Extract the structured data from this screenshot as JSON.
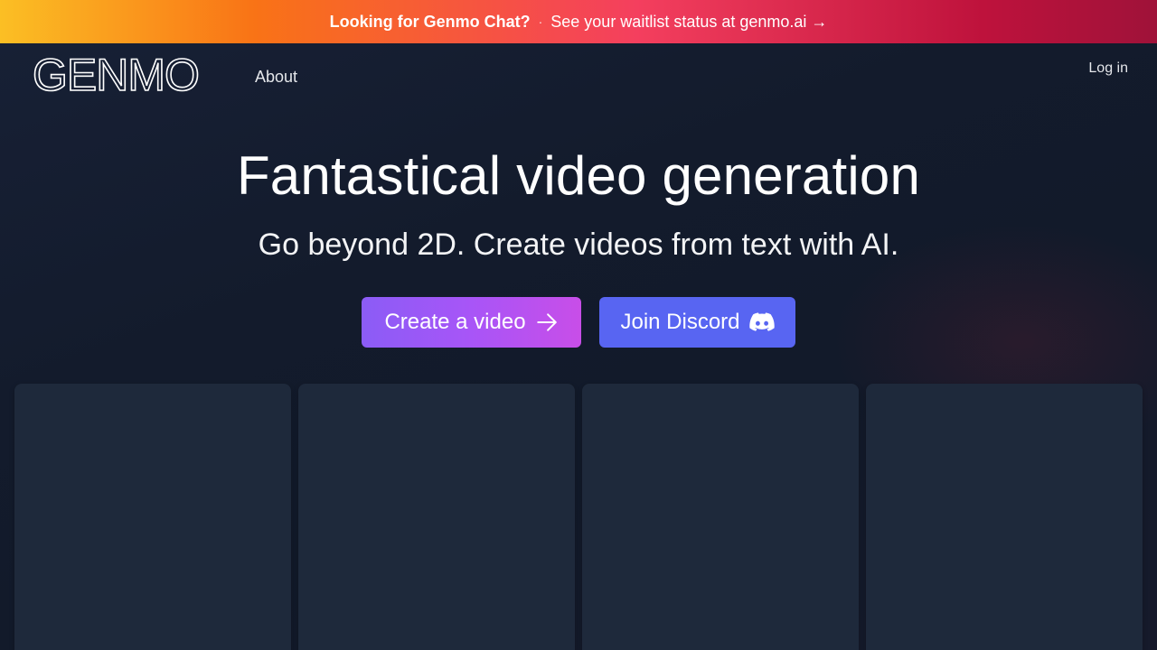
{
  "banner": {
    "headline": "Looking for Genmo Chat?",
    "separator": "·",
    "message": "See your waitlist status at genmo.ai →"
  },
  "header": {
    "logo_text": "GENMO",
    "nav_about": "About",
    "login": "Log in"
  },
  "hero": {
    "title": "Fantastical video generation",
    "subtitle": "Go beyond 2D. Create videos from text with AI.",
    "primary_button": {
      "label": "Create a video",
      "icon": "arrow-right-icon"
    },
    "secondary_button": {
      "label": "Join Discord",
      "icon": "discord-icon"
    }
  },
  "gallery": {
    "cards": [
      {},
      {},
      {},
      {}
    ]
  },
  "colors": {
    "background": "#111827",
    "card": "#1e293b",
    "discord": "#5865f2",
    "create_gradient_start": "#8b5cf6",
    "create_gradient_end": "#c84ee8"
  }
}
